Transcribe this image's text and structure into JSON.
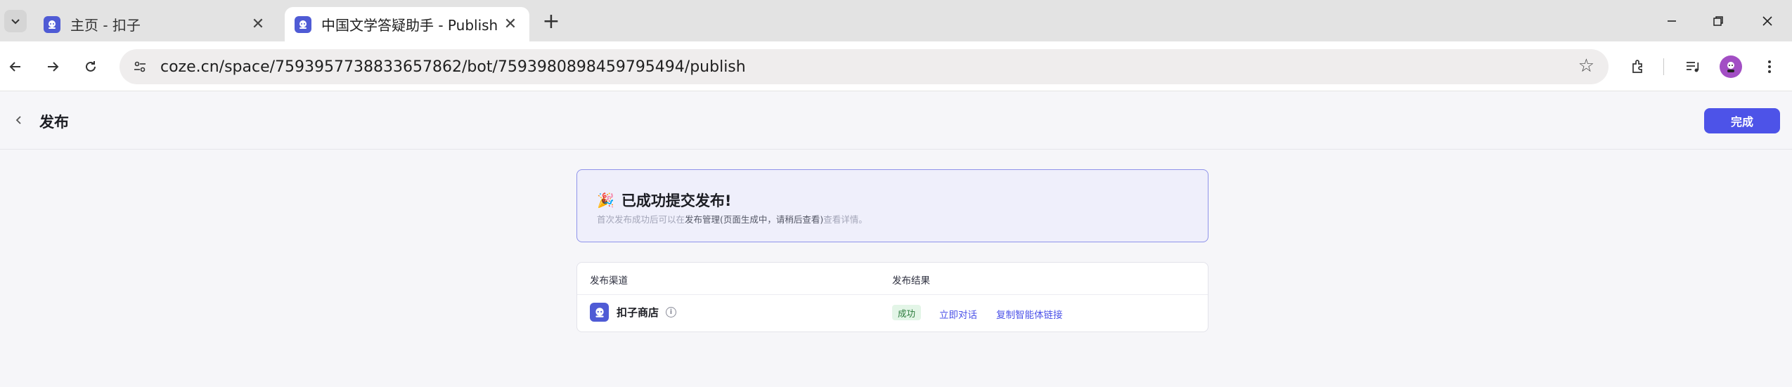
{
  "browser": {
    "tabs": [
      {
        "title": "主页 - 扣子",
        "active": false
      },
      {
        "title": "中国文学答疑助手 - Publish",
        "active": true
      }
    ],
    "url": "coze.cn/space/7593957738833657862/bot/7593980898459795494/publish"
  },
  "header": {
    "title": "发布",
    "done_label": "完成"
  },
  "success": {
    "title": "已成功提交发布!",
    "desc_prefix": "首次发布成功后可以在",
    "desc_link": "发布管理(页面生成中，请稍后查看)",
    "desc_suffix": "查看详情。"
  },
  "results": {
    "col_channel": "发布渠道",
    "col_result": "发布结果",
    "rows": [
      {
        "channel": "扣子商店",
        "status": "成功",
        "action_chat": "立即对话",
        "action_copy": "复制智能体链接"
      }
    ]
  },
  "colors": {
    "accent": "#4d53e8",
    "success_bg": "#e3f5e7",
    "success_text": "#2a7a3b"
  }
}
